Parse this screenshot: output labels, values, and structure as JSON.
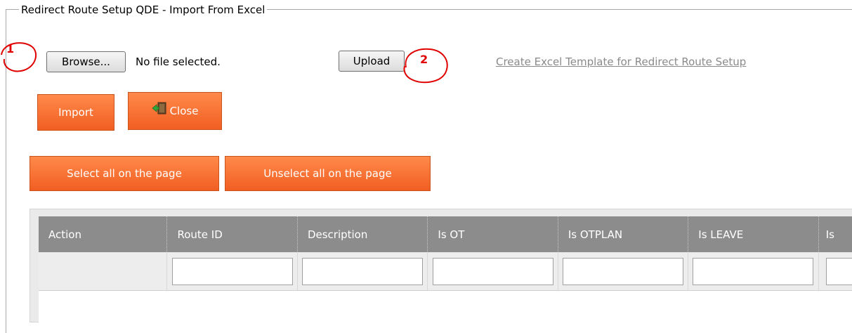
{
  "section": {
    "legend": "Redirect Route Setup QDE - Import From Excel"
  },
  "file_upload": {
    "browse_label": "Browse...",
    "status_text": "No file selected.",
    "upload_label": "Upload",
    "template_link": "Create Excel Template for Redirect Route Setup"
  },
  "actions": {
    "import_label": "Import",
    "close_label": "Close",
    "select_all_label": "Select all on the page",
    "unselect_all_label": "Unselect all on the page"
  },
  "grid": {
    "columns": [
      "Action",
      "Route ID",
      "Description",
      "Is OT",
      "Is OTPLAN",
      "Is LEAVE",
      "Is"
    ]
  },
  "annotations": {
    "marker_1": "1",
    "marker_2": "2",
    "marker_color": "#e00000"
  },
  "colors": {
    "accent_orange": "#f15e22",
    "grid_header": "#8c8c8c",
    "link_gray": "#8a8a8a"
  },
  "icons": {
    "close_button_icon": "exit-door-icon"
  }
}
